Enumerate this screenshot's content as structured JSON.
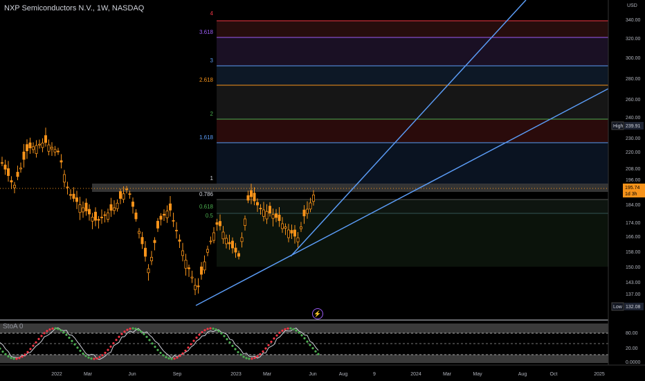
{
  "header": {
    "title": "NXP Semiconductors N.V., 1W, NASDAQ"
  },
  "price_axis": {
    "currency": "USD",
    "ticks": [
      "340.00",
      "320.00",
      "300.00",
      "280.00",
      "260.00",
      "240.00",
      "230.00",
      "220.00",
      "208.00",
      "196.00",
      "184.00",
      "174.00",
      "166.00",
      "158.00",
      "150.00",
      "143.00",
      "137.00",
      "132.08"
    ],
    "high_label": "High",
    "high_value": "239.91",
    "low_label": "Low",
    "low_value": "132.08",
    "last_price": "195.74",
    "countdown": "1d 3h"
  },
  "fib_levels": [
    "4",
    "3.618",
    "3",
    "2.618",
    "2",
    "1.618",
    "1",
    "0.786",
    "0.618",
    "0.5"
  ],
  "oscillator": {
    "label": "StoA 0",
    "ticks": [
      "80.00",
      "20.00",
      "0.0000"
    ]
  },
  "time_axis": [
    "2022",
    "Mar",
    "Jun",
    "Sep",
    "2023",
    "Mar",
    "Jun",
    "Aug",
    "9",
    "2024",
    "Mar",
    "May",
    "Aug",
    "Oct",
    "2025"
  ],
  "colors": {
    "candle": "#f7931a",
    "trendline": "#5b9cf6",
    "accent_purple": "#9c5cf6",
    "osc_up": "#4caf50",
    "osc_down": "#f23645",
    "last_price_bg": "#f7931a"
  }
}
